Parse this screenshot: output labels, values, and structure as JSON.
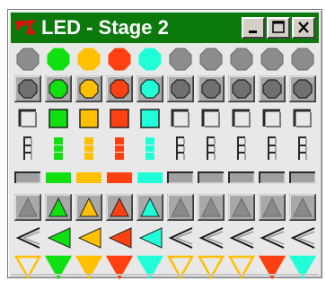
{
  "window": {
    "title": "LED - Stage 2"
  },
  "colors": {
    "titlebar": "#0b7a0b",
    "off": "#5c5c5c",
    "off_hollow": "#2e2e2e",
    "green": "#10e010",
    "yellow": "#ffc000",
    "red": "#ff4010",
    "cyan": "#20ffd8"
  },
  "caption_buttons": [
    {
      "name": "minimize-button",
      "icon": "minimize-icon"
    },
    {
      "name": "maximize-button",
      "icon": "maximize-icon"
    },
    {
      "name": "close-button",
      "icon": "close-icon"
    }
  ],
  "led_rows": [
    {
      "shape": "octagon",
      "states": [
        "off",
        "green",
        "yellow",
        "red",
        "cyan",
        "off",
        "off",
        "off",
        "off",
        "off"
      ]
    },
    {
      "shape": "beveled-octagon",
      "states": [
        "off",
        "green",
        "yellow",
        "red",
        "cyan",
        "off",
        "off",
        "off",
        "off",
        "off"
      ]
    },
    {
      "shape": "square-bracket",
      "states": [
        "off",
        "green",
        "yellow",
        "red",
        "cyan",
        "off",
        "off",
        "off",
        "off",
        "off"
      ]
    },
    {
      "shape": "segment-bars",
      "states": [
        "off",
        "green",
        "yellow",
        "red",
        "cyan",
        "off",
        "off",
        "off",
        "off",
        "off"
      ]
    },
    {
      "shape": "horizontal-bar",
      "states": [
        "off",
        "green",
        "yellow",
        "red",
        "cyan",
        "off",
        "off",
        "off",
        "off",
        "off"
      ]
    },
    {
      "shape": "up-triangle-button",
      "states": [
        "off",
        "green",
        "yellow",
        "red",
        "cyan",
        "off",
        "off",
        "off",
        "off",
        "off"
      ]
    },
    {
      "shape": "left-chevron",
      "states": [
        "off",
        "green",
        "yellow",
        "red",
        "cyan",
        "off",
        "off",
        "off",
        "off",
        "off"
      ]
    },
    {
      "shape": "down-triangle",
      "states": [
        "yellow",
        "green",
        "yellow",
        "red",
        "cyan",
        "yellow",
        "yellow",
        "yellow",
        "red",
        "cyan"
      ]
    }
  ]
}
